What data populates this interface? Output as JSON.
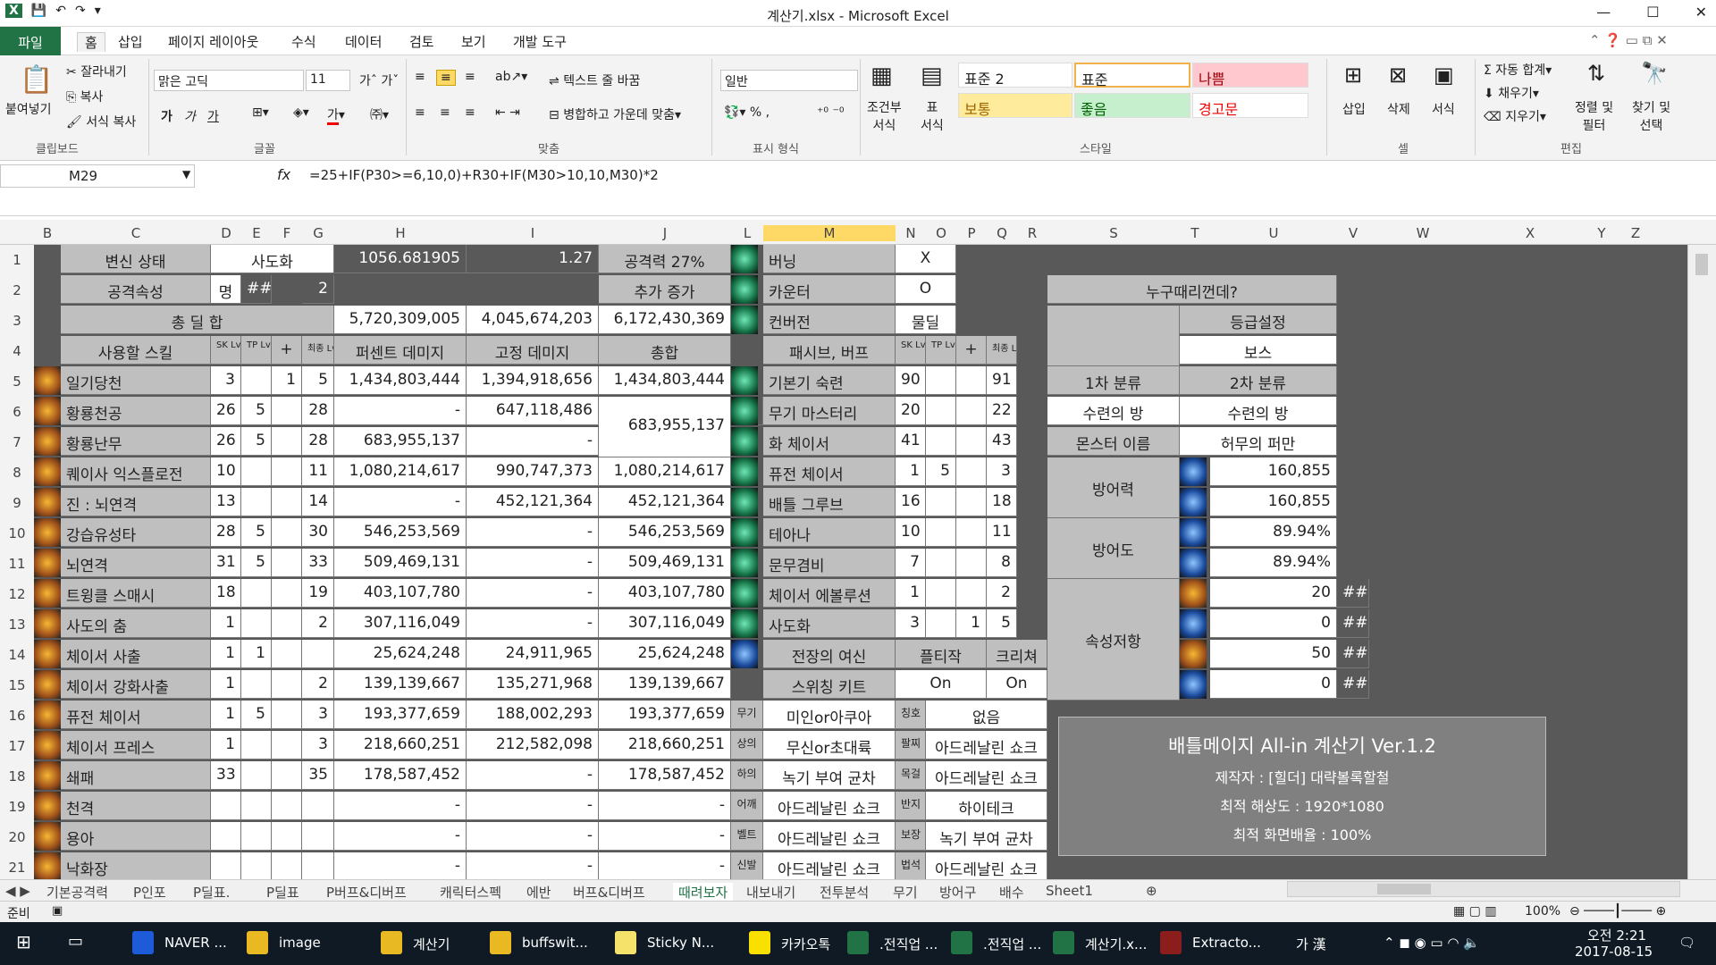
{
  "window": {
    "title": "계산기.xlsx  -  Microsoft Excel"
  },
  "tabs": {
    "file": "파일",
    "home": "홈",
    "insert": "삽입",
    "layout": "페이지 레이아웃",
    "formula": "수식",
    "data": "데이터",
    "review": "검토",
    "view": "보기",
    "dev": "개발 도구"
  },
  "ribbon": {
    "paste": "붙여넣기",
    "cut": "잘라내기",
    "copy": "복사",
    "format_painter": "서식 복사",
    "clipboard": "클립보드",
    "font_name": "맑은 고딕",
    "font_size": "11",
    "font_group": "글꼴",
    "wrap": "텍스트 줄 바꿈",
    "merge": "병합하고 가운데 맞춤",
    "align_group": "맞춤",
    "num_format": "일반",
    "num_group": "표시 형식",
    "cond_format_1": "조건부",
    "cond_format_2": "서식",
    "table_1": "표",
    "table_2": "서식",
    "styles": [
      "표준 2",
      "표준",
      "나쁨",
      "보통",
      "좋음",
      "경고문"
    ],
    "styles_group": "스타일",
    "insert": "삽입",
    "delete": "삭제",
    "format": "서식",
    "cells_group": "셀",
    "autosum": "자동 합계",
    "fill": "채우기",
    "clear": "지우기",
    "sort_1": "정렬 및",
    "sort_2": "필터",
    "find_1": "찾기 및",
    "find_2": "선택",
    "edit_group": "편집"
  },
  "namebox": "M29",
  "formula": "=25+IF(P30>=6,10,0)+R30+IF(M30>10,10,M30)*2",
  "columns": [
    "B",
    "C",
    "D",
    "E",
    "F",
    "G",
    "H",
    "I",
    "J",
    "L",
    "M",
    "N",
    "O",
    "P",
    "Q",
    "R",
    "S",
    "T",
    "U",
    "V",
    "W",
    "X",
    "Y",
    "Z"
  ],
  "rows": [
    "1",
    "2",
    "3",
    "4",
    "5",
    "6",
    "7",
    "8",
    "9",
    "10",
    "11",
    "12",
    "13",
    "14",
    "15",
    "16",
    "17",
    "18",
    "19",
    "20",
    "21"
  ],
  "top": {
    "state_label": "변신 상태",
    "state_val": "사도화",
    "h1": "1056.681905",
    "i1": "1.27",
    "j1a": "공격력 27%",
    "j2": "추가 증가",
    "attr_label": "공격속성",
    "attr_val": "명",
    "e2": "##",
    "g2": "2",
    "total_label": "총 딜 합",
    "total_h": "5,720,309,005",
    "total_i": "4,045,674,203",
    "total_j": "6,172,430,369",
    "skill_hdr": "사용할 스킬",
    "sk": "SK Lv.",
    "tp": "TP Lv.",
    "plus": "+",
    "final": "최종 Lv.",
    "pct": "퍼센트 데미지",
    "fixed": "고정 데미지",
    "sum": "총합"
  },
  "skills": [
    {
      "name": "일기당천",
      "sk": "3",
      "tp": "",
      "plus": "1",
      "fin": "5",
      "pct": "1,434,803,444",
      "fix": "1,394,918,656",
      "sum": "1,434,803,444"
    },
    {
      "name": "황룡천공",
      "sk": "26",
      "tp": "5",
      "plus": "",
      "fin": "28",
      "pct": "-",
      "fix": "647,118,486",
      "sum": "683,955,137"
    },
    {
      "name": "황룡난무",
      "sk": "26",
      "tp": "5",
      "plus": "",
      "fin": "28",
      "pct": "683,955,137",
      "fix": "-",
      "sum": ""
    },
    {
      "name": "퀘이사 익스플로전",
      "sk": "10",
      "tp": "",
      "plus": "",
      "fin": "11",
      "pct": "1,080,214,617",
      "fix": "990,747,373",
      "sum": "1,080,214,617"
    },
    {
      "name": "진 : 뇌연격",
      "sk": "13",
      "tp": "",
      "plus": "",
      "fin": "14",
      "pct": "-",
      "fix": "452,121,364",
      "sum": "452,121,364"
    },
    {
      "name": "강습유성타",
      "sk": "28",
      "tp": "5",
      "plus": "",
      "fin": "30",
      "pct": "546,253,569",
      "fix": "-",
      "sum": "546,253,569"
    },
    {
      "name": "뇌연격",
      "sk": "31",
      "tp": "5",
      "plus": "",
      "fin": "33",
      "pct": "509,469,131",
      "fix": "-",
      "sum": "509,469,131"
    },
    {
      "name": "트윙클 스매시",
      "sk": "18",
      "tp": "",
      "plus": "",
      "fin": "19",
      "pct": "403,107,780",
      "fix": "-",
      "sum": "403,107,780"
    },
    {
      "name": "사도의 춤",
      "sk": "1",
      "tp": "",
      "plus": "",
      "fin": "2",
      "pct": "307,116,049",
      "fix": "-",
      "sum": "307,116,049"
    },
    {
      "name": "체이서 사출",
      "sk": "1",
      "tp": "1",
      "plus": "",
      "fin": "",
      "pct": "25,624,248",
      "fix": "24,911,965",
      "sum": "25,624,248"
    },
    {
      "name": "체이서 강화사출",
      "sk": "1",
      "tp": "",
      "plus": "",
      "fin": "2",
      "pct": "139,139,667",
      "fix": "135,271,968",
      "sum": "139,139,667"
    },
    {
      "name": "퓨전 체이서",
      "sk": "1",
      "tp": "5",
      "plus": "",
      "fin": "3",
      "pct": "193,377,659",
      "fix": "188,002,293",
      "sum": "193,377,659"
    },
    {
      "name": "체이서 프레스",
      "sk": "1",
      "tp": "",
      "plus": "",
      "fin": "3",
      "pct": "218,660,251",
      "fix": "212,582,098",
      "sum": "218,660,251"
    },
    {
      "name": "쇄패",
      "sk": "33",
      "tp": "",
      "plus": "",
      "fin": "35",
      "pct": "178,587,452",
      "fix": "-",
      "sum": "178,587,452"
    },
    {
      "name": "천격",
      "sk": "",
      "tp": "",
      "plus": "",
      "fin": "",
      "pct": "-",
      "fix": "-",
      "sum": "-"
    },
    {
      "name": "용아",
      "sk": "",
      "tp": "",
      "plus": "",
      "fin": "",
      "pct": "-",
      "fix": "-",
      "sum": "-"
    },
    {
      "name": "낙화장",
      "sk": "",
      "tp": "",
      "plus": "",
      "fin": "",
      "pct": "-",
      "fix": "-",
      "sum": "-"
    }
  ],
  "l6": "20",
  "buffs_top": [
    {
      "name": "버닝",
      "val": "X"
    },
    {
      "name": "카운터",
      "val": "O"
    },
    {
      "name": "컨버전",
      "val": "물딜"
    }
  ],
  "passive_hdr": "패시브, 버프",
  "passives": [
    {
      "name": "기본기 숙련",
      "sk": "90",
      "tp": "",
      "plus": "",
      "fin": "91"
    },
    {
      "name": "무기 마스터리",
      "sk": "20",
      "tp": "",
      "plus": "",
      "fin": "22"
    },
    {
      "name": "화 체이서",
      "sk": "41",
      "tp": "",
      "plus": "",
      "fin": "43"
    },
    {
      "name": "퓨전 체이서",
      "sk": "1",
      "tp": "5",
      "plus": "",
      "fin": "3"
    },
    {
      "name": "배틀 그루브",
      "sk": "16",
      "tp": "",
      "plus": "",
      "fin": "18"
    },
    {
      "name": "테아나",
      "sk": "10",
      "tp": "",
      "plus": "",
      "fin": "11"
    },
    {
      "name": "문무겸비",
      "sk": "7",
      "tp": "",
      "plus": "",
      "fin": "8"
    },
    {
      "name": "체이서 에볼루션",
      "sk": "1",
      "tp": "",
      "plus": "",
      "fin": "2"
    },
    {
      "name": "사도화",
      "sk": "3",
      "tp": "",
      "plus": "1",
      "fin": "5"
    }
  ],
  "switch": {
    "title1": "전장의 여신",
    "title2": "스위칭 키트",
    "plt": "플티작",
    "crit": "크리쳐",
    "on1": "On",
    "on2": "On"
  },
  "equip": [
    {
      "k1": "무기",
      "v1": "미인or아쿠아",
      "k2": "칭호",
      "v2": "없음"
    },
    {
      "k1": "상의",
      "v1": "무신or초대륙",
      "k2": "팔찌",
      "v2": "아드레날린 쇼크"
    },
    {
      "k1": "하의",
      "v1": "녹기 부여 균차",
      "k2": "목걸",
      "v2": "아드레날린 쇼크"
    },
    {
      "k1": "어깨",
      "v1": "아드레날린 쇼크",
      "k2": "반지",
      "v2": "하이테크"
    },
    {
      "k1": "벨트",
      "v1": "아드레날린 쇼크",
      "k2": "보장",
      "v2": "녹기 부여 균차"
    },
    {
      "k1": "신발",
      "v1": "아드레날린 쇼크",
      "k2": "법석",
      "v2": "아드레날린 쇼크"
    }
  ],
  "target": {
    "title": "누구때리껀데?",
    "grade_label": "등급설정",
    "grade": "보스",
    "cls1": "1차 분류",
    "cls2": "2차 분류",
    "r1": "수련의 방",
    "r2": "수련의 방",
    "mon_label": "몬스터 이름",
    "mon": "허무의 퍼만",
    "def_label": "방어력",
    "def1": "160,855",
    "def2": "160,855",
    "defr_label": "방어도",
    "defr1": "89.94%",
    "defr2": "89.94%",
    "res_label": "속성저항",
    "res": [
      "20",
      "0",
      "50",
      "0"
    ],
    "hash": "##"
  },
  "info": {
    "title": "배틀메이지 All-in 계산기 Ver.1.2",
    "author": "제작자 : [힐더] 대략볼록할철",
    "res": "최적 해상도 : 1920*1080",
    "zoom": "최적 화면배율 : 100%"
  },
  "sheettabs": [
    "기본공격력",
    "P인포",
    "P딜표.",
    "P딜표",
    "P버프&디버프",
    "캐릭터스펙",
    "에반",
    "버프&디버프",
    "때려보자",
    "내보내기",
    "전투분석",
    "무기",
    "방어구",
    "배수",
    "Sheet1"
  ],
  "status": {
    "ready": "준비",
    "zoom": "100%"
  },
  "taskbar": {
    "items": [
      "NAVER ...",
      "image",
      "계산기",
      "buffswit...",
      "Sticky N...",
      "카카오톡",
      ".전직업 ...",
      ".전직업 ...",
      "계산기.x...",
      "Extracto..."
    ],
    "ime": "가 漢",
    "time": "오전 2:21",
    "date": "2017-08-15"
  },
  "colors": {
    "excel_green": "#217346",
    "sheet_bg": "#595959",
    "cell_gray": "#bfbfbf",
    "highlight": "#ffd966"
  }
}
